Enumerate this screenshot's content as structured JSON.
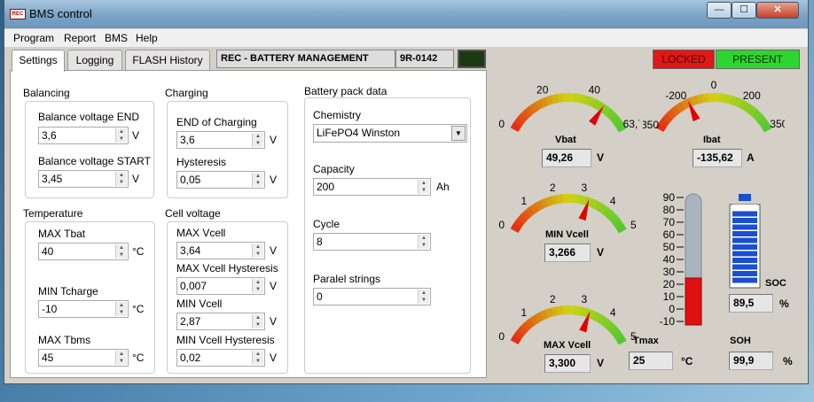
{
  "window": {
    "title": "BMS control",
    "icon_text": "REC"
  },
  "window_buttons": {
    "minimize": "—",
    "maximize": "☐",
    "close": "✕"
  },
  "menu": [
    "Program",
    "Report",
    "BMS",
    "Help"
  ],
  "tabs": [
    "Settings",
    "Logging",
    "FLASH History"
  ],
  "header": {
    "name": "REC - BATTERY MANAGEMENT",
    "code": "9R-0142"
  },
  "status": {
    "locked": "LOCKED",
    "present": "PRESENT"
  },
  "balancing": {
    "title": "Balancing",
    "end_label": "Balance voltage END",
    "end_value": "3,6",
    "end_unit": "V",
    "start_label": "Balance voltage START",
    "start_value": "3,45",
    "start_unit": "V"
  },
  "charging": {
    "title": "Charging",
    "end_label": "END of Charging",
    "end_value": "3,6",
    "end_unit": "V",
    "hyst_label": "Hysteresis",
    "hyst_value": "0,05",
    "hyst_unit": "V"
  },
  "temperature": {
    "title": "Temperature",
    "max_tbat_label": "MAX Tbat",
    "max_tbat_value": "40",
    "max_tbat_unit": "°C",
    "min_tcharge_label": "MIN Tcharge",
    "min_tcharge_value": "-10",
    "min_tcharge_unit": "°C",
    "max_tbms_label": "MAX Tbms",
    "max_tbms_value": "45",
    "max_tbms_unit": "°C"
  },
  "cell_voltage": {
    "title": "Cell voltage",
    "max_label": "MAX Vcell",
    "max_value": "3,64",
    "max_unit": "V",
    "max_hyst_label": "MAX Vcell Hysteresis",
    "max_hyst_value": "0,007",
    "max_hyst_unit": "V",
    "min_label": "MIN Vcell",
    "min_value": "2,87",
    "min_unit": "V",
    "min_hyst_label": "MIN Vcell Hysteresis",
    "min_hyst_value": "0,02",
    "min_hyst_unit": "V"
  },
  "battery_pack": {
    "title": "Battery pack data",
    "chemistry_label": "Chemistry",
    "chemistry_value": "LiFePO4 Winston",
    "capacity_label": "Capacity",
    "capacity_value": "200",
    "capacity_unit": "Ah",
    "cycle_label": "Cycle",
    "cycle_value": "8",
    "paralel_label": "Paralel strings",
    "paralel_value": "0"
  },
  "gauges": {
    "vbat": {
      "label": "Vbat",
      "value": "49,26",
      "unit": "V",
      "ticks": [
        "0",
        "20",
        "40",
        "63,7"
      ],
      "min": 0,
      "max": 63.7,
      "reading": 49.26
    },
    "ibat": {
      "label": "Ibat",
      "value": "-135,62",
      "unit": "A",
      "ticks": [
        "350",
        "-200",
        "0",
        "200",
        "350"
      ],
      "min": -350,
      "max": 350,
      "reading": -135.62
    },
    "min_vcell": {
      "label": "MIN Vcell",
      "value": "3,266",
      "unit": "V",
      "ticks": [
        "0",
        "1",
        "2",
        "3",
        "4",
        "5"
      ],
      "min": 0,
      "max": 5,
      "reading": 3.266
    },
    "max_vcell": {
      "label": "MAX Vcell",
      "value": "3,300",
      "unit": "V",
      "ticks": [
        "0",
        "1",
        "2",
        "3",
        "4",
        "5"
      ],
      "min": 0,
      "max": 5,
      "reading": 3.3
    }
  },
  "tmax": {
    "label": "Tmax",
    "value": "25",
    "unit": "°C",
    "ticks": [
      "90",
      "80",
      "70",
      "60",
      "50",
      "40",
      "30",
      "20",
      "10",
      "0",
      "-10"
    ],
    "min": -10,
    "max": 90,
    "reading": 25
  },
  "soc": {
    "label": "SOC",
    "value": "89,5",
    "unit": "%",
    "fraction": 0.895
  },
  "soh": {
    "label": "SOH",
    "value": "99,9",
    "unit": "%"
  },
  "colors": {
    "locked": "#e01818",
    "present": "#2fd52f",
    "needle": "#e00000",
    "soc_bar": "#1a4fd0",
    "thermo_fill": "#e01010"
  }
}
